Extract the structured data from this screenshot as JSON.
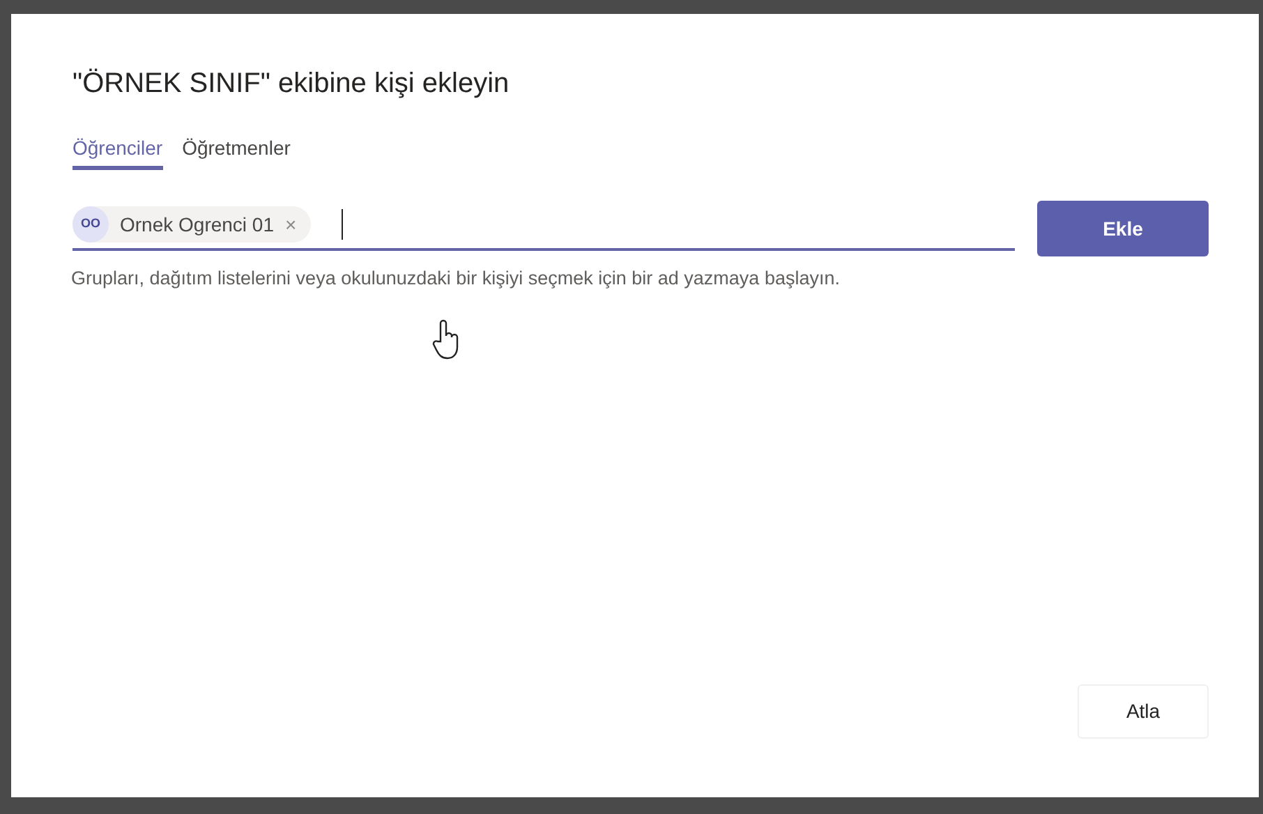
{
  "dialog": {
    "title": "\"ÖRNEK SINIF\" ekibine kişi ekleyin",
    "tabs": [
      {
        "label": "Öğrenciler",
        "selected": true
      },
      {
        "label": "Öğretmenler",
        "selected": false
      }
    ],
    "people_picker": {
      "chips": [
        {
          "initials": "OO",
          "name": "Ornek Ogrenci 01",
          "remove": "×"
        }
      ]
    },
    "add_button": "Ekle",
    "hint": "Grupları, dağıtım listelerini veya okulunuzdaki bir kişiyi seçmek için bir ad yazmaya başlayın.",
    "skip_button": "Atla"
  }
}
